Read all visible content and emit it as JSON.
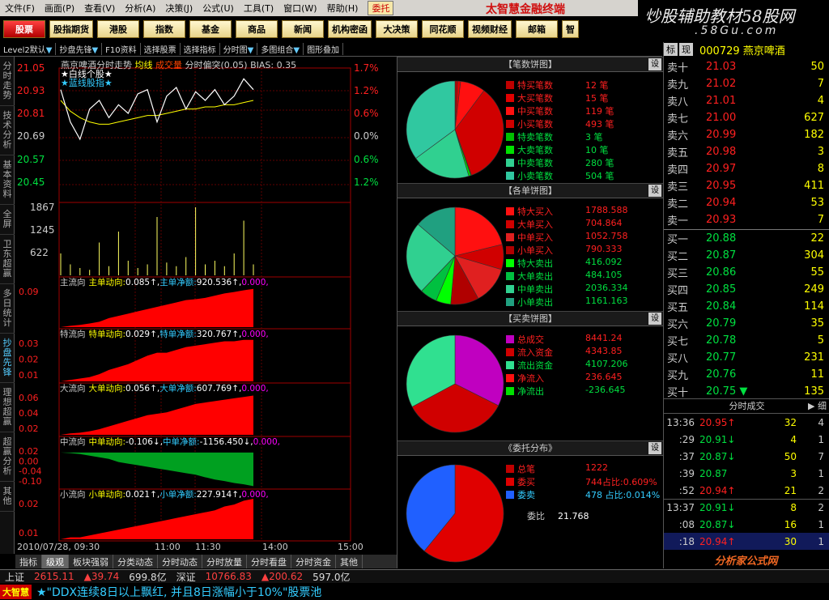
{
  "menu": {
    "items": [
      "文件(F)",
      "画面(P)",
      "查看(V)",
      "分析(A)",
      "决策(J)",
      "公式(U)",
      "工具(T)",
      "窗口(W)",
      "帮助(H)"
    ],
    "entrust": "委托",
    "brand": "太智慧金融终端"
  },
  "watermark": {
    "line1": "炒股辅助教材58股网",
    "line2": ".58Gu.com"
  },
  "nav": {
    "items": [
      "股票",
      "股指期货",
      "港股",
      "指数",
      "基金",
      "商品",
      "新闻",
      "机构密函",
      "大决策",
      "同花顺",
      "视频财经",
      "邮箱",
      "智"
    ]
  },
  "toolbar": {
    "items": [
      "Level2默认",
      "抄盘先锋",
      "F10资料",
      "选择股票",
      "选择指标",
      "分时图",
      "多图组合",
      "图形叠加"
    ],
    "tab_a": "标",
    "tab_b": "现",
    "settings": "设"
  },
  "leftnav": {
    "items": [
      "分时走势",
      "技术分析",
      "基本资料",
      "全屏",
      "卫东超赢",
      "多日统计",
      "抄盘先锋",
      "理想超赢",
      "超赢分析",
      "其他"
    ]
  },
  "chart": {
    "title": {
      "name": "燕京啤酒分时走势",
      "avg": "均线",
      "vol": "成交量",
      "info": "分时偏突(0.05) BIAS: 0.35"
    },
    "legend": {
      "l1": "★白线个股★",
      "l2": "★蓝线股指★"
    },
    "price_labels": [
      "21.05",
      "20.93",
      "20.81",
      "20.69",
      "20.57",
      "20.45"
    ],
    "pct_labels": [
      "1.7%",
      "1.2%",
      "0.6%",
      "0.0%",
      "0.6%",
      "1.2%"
    ],
    "vol_labels": [
      "1867",
      "1245",
      "622"
    ],
    "flows": [
      {
        "label": "主流向",
        "a": "主单动向:",
        "av": "0.085↑,",
        "b": "主单净额:",
        "bv": "920.536↑,",
        "c": "0.000,",
        "ticks": [
          "0.09"
        ],
        "color": "#ff0000",
        "ylim": [
          0,
          0.09
        ]
      },
      {
        "label": "特流向",
        "a": "特单动向:",
        "av": "0.029↑,",
        "b": "特单净额:",
        "bv": "320.767↑,",
        "c": "0.000,",
        "ticks": [
          "0.03",
          "0.02",
          "0.01"
        ],
        "color": "#ff0000",
        "ylim": [
          0,
          0.03
        ]
      },
      {
        "label": "大流向",
        "a": "大单动向:",
        "av": "0.056↑,",
        "b": "大单净额:",
        "bv": "607.769↑,",
        "c": "0.000,",
        "ticks": [
          "0.06",
          "0.04",
          "0.02"
        ],
        "color": "#ff0000",
        "ylim": [
          0,
          0.06
        ]
      },
      {
        "label": "中流向",
        "a": "中单动向:",
        "av": "-0.106↓,",
        "b": "中单净额:",
        "bv": "-1156.450↓,",
        "c": "0.000,",
        "ticks": [
          "0.02",
          "0.00",
          "-0.04",
          "-0.10"
        ],
        "color": "#00a020",
        "ylim": [
          -0.11,
          0.02
        ]
      },
      {
        "label": "小流向",
        "a": "小单动向:",
        "av": "0.021↑,",
        "b": "小单净额:",
        "bv": "227.914↑,",
        "c": "0.000,",
        "ticks": [
          "0.02",
          "0.01"
        ],
        "color": "#ff0000",
        "ylim": [
          0,
          0.021
        ]
      }
    ],
    "time_axis": [
      "2010/07/28, 09:30",
      "11:00",
      "11:30",
      "14:00",
      "15:00"
    ]
  },
  "chart_data": [
    {
      "type": "line",
      "title": "燕京啤酒分时走势",
      "series": [
        {
          "name": "均线",
          "values": [
            20.9,
            20.85,
            20.82,
            20.8,
            20.79,
            20.79,
            20.8,
            20.81,
            20.82,
            20.83,
            20.83,
            20.84,
            20.85,
            20.86,
            20.86,
            20.87,
            20.87,
            20.88,
            20.88,
            20.89,
            20.9
          ]
        },
        {
          "values": [
            20.95,
            20.8,
            20.72,
            20.86,
            20.9,
            20.82,
            20.88,
            20.84,
            20.93,
            20.95,
            20.8,
            20.92,
            20.96,
            20.86,
            20.94,
            20.9,
            20.95,
            20.88,
            20.92,
            21.0,
            20.95
          ]
        }
      ],
      "ylim": [
        20.45,
        21.05
      ]
    },
    {
      "type": "bar",
      "series": [
        {
          "name": "成交量",
          "values": [
            600,
            300,
            200,
            150,
            900,
            250,
            1200,
            400,
            200,
            300,
            1600,
            350,
            250,
            500,
            1867,
            300,
            400,
            250,
            600,
            1500,
            300
          ]
        }
      ],
      "ylim": [
        0,
        1867
      ]
    },
    {
      "type": "area",
      "series": [
        {
          "name": "主单动向",
          "values": [
            0,
            0.003,
            0.005,
            0.008,
            0.012,
            0.02,
            0.025,
            0.03,
            0.035,
            0.04,
            0.045,
            0.05,
            0.055,
            0.06,
            0.062,
            0.065,
            0.07,
            0.075,
            0.078,
            0.082,
            0.085
          ]
        }
      ]
    },
    {
      "type": "area",
      "series": [
        {
          "name": "特单动向",
          "values": [
            0,
            0.001,
            0.002,
            0.003,
            0.005,
            0.008,
            0.01,
            0.012,
            0.015,
            0.018,
            0.02,
            0.02,
            0.022,
            0.024,
            0.025,
            0.026,
            0.027,
            0.028,
            0.028,
            0.029,
            0.029
          ]
        }
      ]
    },
    {
      "type": "area",
      "series": [
        {
          "name": "大单动向",
          "values": [
            0,
            0.002,
            0.003,
            0.005,
            0.008,
            0.012,
            0.016,
            0.02,
            0.024,
            0.028,
            0.03,
            0.032,
            0.036,
            0.04,
            0.044,
            0.046,
            0.048,
            0.05,
            0.052,
            0.054,
            0.056
          ]
        }
      ]
    },
    {
      "type": "area",
      "series": [
        {
          "name": "中单动向",
          "values": [
            0,
            -0.002,
            -0.005,
            -0.01,
            -0.015,
            -0.02,
            -0.03,
            -0.035,
            -0.04,
            -0.045,
            -0.05,
            -0.055,
            -0.06,
            -0.065,
            -0.07,
            -0.078,
            -0.085,
            -0.09,
            -0.096,
            -0.1,
            -0.106
          ]
        }
      ]
    },
    {
      "type": "area",
      "series": [
        {
          "name": "小单动向",
          "values": [
            0,
            0.001,
            0.001,
            0.002,
            0.003,
            0.004,
            0.005,
            0.006,
            0.007,
            0.008,
            0.009,
            0.01,
            0.011,
            0.012,
            0.013,
            0.014,
            0.015,
            0.017,
            0.018,
            0.02,
            0.021
          ]
        }
      ]
    },
    {
      "type": "pie",
      "title": "笔数饼图",
      "series": [
        {
          "name": "特买笔数",
          "values": [
            12
          ]
        },
        {
          "name": "大买笔数",
          "values": [
            15
          ]
        },
        {
          "name": "中买笔数",
          "values": [
            119
          ]
        },
        {
          "name": "小买笔数",
          "values": [
            493
          ]
        },
        {
          "name": "特卖笔数",
          "values": [
            3
          ]
        },
        {
          "name": "大卖笔数",
          "values": [
            10
          ]
        },
        {
          "name": "中卖笔数",
          "values": [
            280
          ]
        },
        {
          "name": "小卖笔数",
          "values": [
            504
          ]
        }
      ]
    },
    {
      "type": "pie",
      "title": "各单饼图",
      "series": [
        {
          "name": "特大买入",
          "values": [
            1788.588
          ]
        },
        {
          "name": "大单买入",
          "values": [
            704.864
          ]
        },
        {
          "name": "中单买入",
          "values": [
            1052.758
          ]
        },
        {
          "name": "小单买入",
          "values": [
            790.333
          ]
        },
        {
          "name": "特大卖出",
          "values": [
            416.092
          ]
        },
        {
          "name": "大单卖出",
          "values": [
            484.105
          ]
        },
        {
          "name": "中单卖出",
          "values": [
            2036.334
          ]
        },
        {
          "name": "小单卖出",
          "values": [
            1161.163
          ]
        }
      ]
    },
    {
      "type": "pie",
      "title": "买卖饼图",
      "series": [
        {
          "name": "总成交",
          "values": [
            8441.24
          ]
        },
        {
          "name": "流入资金",
          "values": [
            4343.85
          ]
        },
        {
          "name": "流出资金",
          "values": [
            4107.206
          ]
        }
      ]
    },
    {
      "type": "pie",
      "title": "委托分布",
      "series": [
        {
          "name": "总笔",
          "values": [
            1222
          ]
        },
        {
          "name": "委买",
          "values": [
            744
          ]
        },
        {
          "name": "委卖",
          "values": [
            478
          ]
        }
      ]
    }
  ],
  "pies": [
    {
      "head": "【笔数饼图】",
      "items": [
        {
          "n": "特买笔数",
          "v": "12 笔",
          "c": "#c00000"
        },
        {
          "n": "大买笔数",
          "v": "15 笔",
          "c": "#e00000"
        },
        {
          "n": "中买笔数",
          "v": "119 笔",
          "c": "#ff1010"
        },
        {
          "n": "小买笔数",
          "v": "493 笔",
          "c": "#d00000"
        },
        {
          "n": "特卖笔数",
          "v": "3 笔",
          "c": "#00c000"
        },
        {
          "n": "大卖笔数",
          "v": "10 笔",
          "c": "#00e000"
        },
        {
          "n": "中卖笔数",
          "v": "280 笔",
          "c": "#30d090"
        },
        {
          "n": "小卖笔数",
          "v": "504 笔",
          "c": "#30c8a0"
        }
      ]
    },
    {
      "head": "【各单饼图】",
      "items": [
        {
          "n": "特大买入",
          "v": "1788.588",
          "c": "#ff1010"
        },
        {
          "n": "大单买入",
          "v": "704.864",
          "c": "#d00000"
        },
        {
          "n": "中单买入",
          "v": "1052.758",
          "c": "#e02020"
        },
        {
          "n": "小单买入",
          "v": "790.333",
          "c": "#b00000"
        },
        {
          "n": "特大卖出",
          "v": "416.092",
          "c": "#00ff00"
        },
        {
          "n": "大单卖出",
          "v": "484.105",
          "c": "#00c040"
        },
        {
          "n": "中单卖出",
          "v": "2036.334",
          "c": "#30d090"
        },
        {
          "n": "小单卖出",
          "v": "1161.163",
          "c": "#20a080"
        }
      ]
    },
    {
      "head": "【买卖饼图】",
      "items": [
        {
          "n": "总成交",
          "v": "8441.24",
          "c": "#c000c0"
        },
        {
          "n": "流入资金",
          "v": "4343.85",
          "c": "#d00000"
        },
        {
          "n": "流出资金",
          "v": "4107.206",
          "c": "#30e090"
        },
        {
          "n": "净流入",
          "v": "236.645",
          "c": "#ff1010"
        },
        {
          "n": "净流出",
          "v": "-236.645",
          "c": "#00e000"
        }
      ]
    },
    {
      "head": "《委托分布》",
      "items": [
        {
          "n": "总笔",
          "v": "1222",
          "c": "#c00000"
        },
        {
          "n": "委买",
          "v": "744占比:0.609%",
          "c": "#e00000"
        },
        {
          "n": "委卖",
          "v": "478 占比:0.014%",
          "c": "#2060ff"
        }
      ],
      "extra": {
        "k": "委比",
        "v": "21.768"
      }
    }
  ],
  "right": {
    "tab_a": "标",
    "tab_b": "现",
    "code": "000729 燕京啤酒",
    "asks": [
      {
        "l": "卖十",
        "p": "21.03",
        "q": "50"
      },
      {
        "l": "卖九",
        "p": "21.02",
        "q": "7"
      },
      {
        "l": "卖八",
        "p": "21.01",
        "q": "4"
      },
      {
        "l": "卖七",
        "p": "21.00",
        "q": "627"
      },
      {
        "l": "卖六",
        "p": "20.99",
        "q": "182"
      },
      {
        "l": "卖五",
        "p": "20.98",
        "q": "3"
      },
      {
        "l": "卖四",
        "p": "20.97",
        "q": "8"
      },
      {
        "l": "卖三",
        "p": "20.95",
        "q": "411"
      },
      {
        "l": "卖二",
        "p": "20.94",
        "q": "53"
      },
      {
        "l": "卖一",
        "p": "20.93",
        "q": "7"
      }
    ],
    "bids": [
      {
        "l": "买一",
        "p": "20.88",
        "q": "22"
      },
      {
        "l": "买二",
        "p": "20.87",
        "q": "304"
      },
      {
        "l": "买三",
        "p": "20.86",
        "q": "55"
      },
      {
        "l": "买四",
        "p": "20.85",
        "q": "249"
      },
      {
        "l": "买五",
        "p": "20.84",
        "q": "114"
      },
      {
        "l": "买六",
        "p": "20.79",
        "q": "35"
      },
      {
        "l": "买七",
        "p": "20.78",
        "q": "5"
      },
      {
        "l": "买八",
        "p": "20.77",
        "q": "231"
      },
      {
        "l": "买九",
        "p": "20.76",
        "q": "11"
      },
      {
        "l": "买十",
        "p": "20.75 ▼",
        "q": "135"
      }
    ],
    "tick_header": "分时成交",
    "tick_side": "▶ 细",
    "ticks": [
      {
        "t": "13:36",
        "p": "20.95↑",
        "v": "32",
        "c": "4",
        "up": true
      },
      {
        "t": ":29",
        "p": "20.91↓",
        "v": "4",
        "c": "1",
        "up": false
      },
      {
        "t": ":37",
        "p": "20.87↓",
        "v": "50",
        "c": "7",
        "up": false
      },
      {
        "t": ":39",
        "p": "20.87",
        "v": "3",
        "c": "1",
        "up": false
      },
      {
        "t": ":52",
        "p": "20.94↑",
        "v": "21",
        "c": "2",
        "up": true
      },
      {
        "t": "13:37",
        "p": "20.91↓",
        "v": "8",
        "c": "2",
        "up": false
      },
      {
        "t": ":08",
        "p": "20.87↓",
        "v": "16",
        "c": "1",
        "up": false
      },
      {
        "t": ":18",
        "p": "20.94↑",
        "v": "30",
        "c": "1",
        "up": true
      }
    ],
    "mark": "分析家公式网"
  },
  "status": {
    "market1": "上证",
    "idx1": "2615.11",
    "chg1": "▲39.74",
    "amt1": "699.8亿",
    "market2": "深证",
    "idx2": "10766.83",
    "chg2": "▲200.62",
    "amt2": "597.0亿"
  },
  "scroll": {
    "tag": "大智慧",
    "text": "★\"DDX连续8日以上飘红, 并且8日涨幅小于10%\"股票池"
  },
  "colors": {
    "up": "#ff2020",
    "down": "#00e040",
    "bg": "#000000",
    "accent": "#ffff00"
  }
}
